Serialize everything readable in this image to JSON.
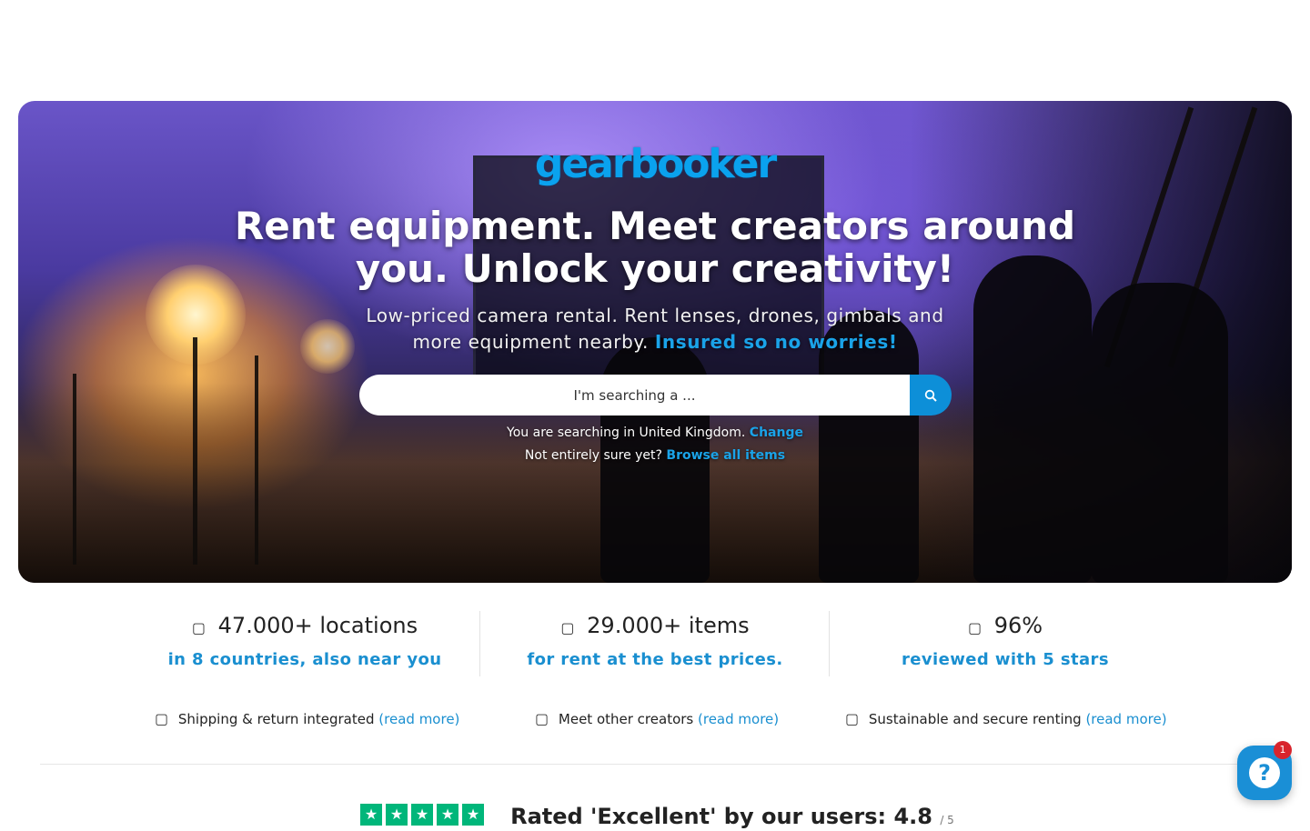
{
  "hero": {
    "logo": "gearbooker",
    "headline": "Rent equipment. Meet creators around you. Unlock your creativity!",
    "subline": "Low-priced camera rental. Rent lenses, drones, gimbals and more equipment nearby.",
    "subline_accent": "Insured so no worries!",
    "search": {
      "placeholder": "I'm searching a ...",
      "button_icon": "search-icon"
    },
    "location_text": "You are searching in United Kingdom.",
    "location_change": "Change",
    "browse_text": "Not entirely sure yet?",
    "browse_link": "Browse all items"
  },
  "stats": [
    {
      "icon": "map-marker-icon",
      "value": "47.000+ locations",
      "sub": "in 8 countries, also near you"
    },
    {
      "icon": "camera-icon",
      "value": "29.000+ items",
      "sub": "for rent at the best prices."
    },
    {
      "icon": "star-icon",
      "value": "96%",
      "sub": "reviewed with 5 stars"
    }
  ],
  "features": [
    {
      "icon": "truck-icon",
      "text": "Shipping & return integrated",
      "link": "(read more)"
    },
    {
      "icon": "users-icon",
      "text": "Meet other creators",
      "link": "(read more)"
    },
    {
      "icon": "shield-icon",
      "text": "Sustainable and secure renting",
      "link": "(read more)"
    }
  ],
  "rating": {
    "text": "Rated 'Excellent' by our users: 4.8",
    "out_of": "/ 5"
  },
  "help_widget": {
    "icon": "question-icon",
    "badge": "1"
  },
  "colors": {
    "accent": "#1a8fd0",
    "search_button": "#0d8fd8",
    "trustpilot_green": "#00b67a",
    "badge_red": "#d8242c"
  }
}
